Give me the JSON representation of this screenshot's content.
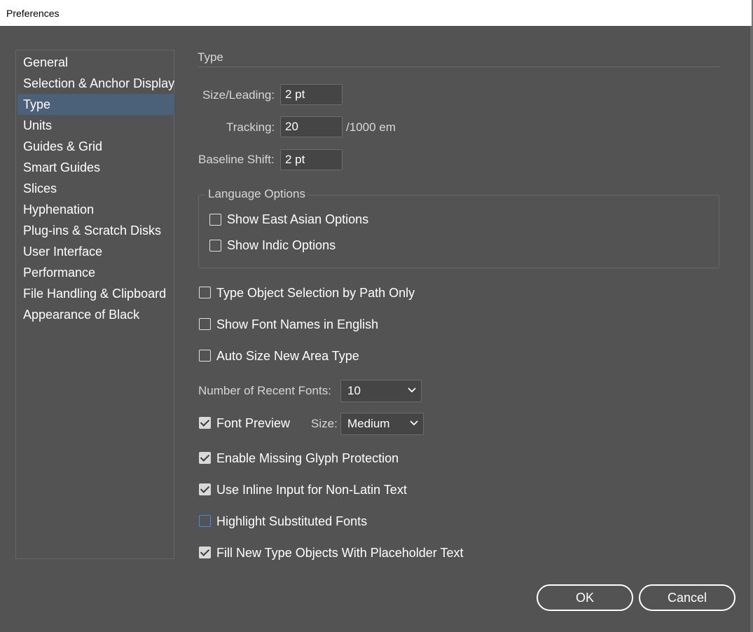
{
  "window": {
    "title": "Preferences"
  },
  "sidebar": {
    "items": [
      {
        "label": "General"
      },
      {
        "label": "Selection & Anchor Display"
      },
      {
        "label": "Type"
      },
      {
        "label": "Units"
      },
      {
        "label": "Guides & Grid"
      },
      {
        "label": "Smart Guides"
      },
      {
        "label": "Slices"
      },
      {
        "label": "Hyphenation"
      },
      {
        "label": "Plug-ins & Scratch Disks"
      },
      {
        "label": "User Interface"
      },
      {
        "label": "Performance"
      },
      {
        "label": "File Handling & Clipboard"
      },
      {
        "label": "Appearance of Black"
      }
    ],
    "selected": "Type"
  },
  "main": {
    "section_title": "Type",
    "size_leading": {
      "label": "Size/Leading:",
      "value": "2 pt"
    },
    "tracking": {
      "label": "Tracking:",
      "value": "20",
      "unit": "/1000 em"
    },
    "baseline_shift": {
      "label": "Baseline Shift:",
      "value": "2 pt"
    },
    "language_options": {
      "title": "Language Options",
      "east_asian": {
        "label": "Show East Asian Options",
        "checked": false
      },
      "indic": {
        "label": "Show Indic Options",
        "checked": false
      }
    },
    "type_object_selection": {
      "label": "Type Object Selection by Path Only",
      "checked": false
    },
    "font_names_english": {
      "label": "Show Font Names in English",
      "checked": false
    },
    "auto_size": {
      "label": "Auto Size New Area Type",
      "checked": false
    },
    "recent_fonts": {
      "label": "Number of Recent Fonts:",
      "value": "10"
    },
    "font_preview": {
      "label": "Font Preview",
      "checked": true,
      "size_label": "Size:",
      "size_value": "Medium"
    },
    "missing_glyph": {
      "label": "Enable Missing Glyph Protection",
      "checked": true
    },
    "inline_input": {
      "label": "Use Inline Input for Non-Latin Text",
      "checked": true
    },
    "highlight_substituted": {
      "label": "Highlight Substituted Fonts",
      "checked": false
    },
    "placeholder_text": {
      "label": "Fill New Type Objects With Placeholder Text",
      "checked": true
    }
  },
  "buttons": {
    "ok": "OK",
    "cancel": "Cancel"
  },
  "colors": {
    "background": "#535353",
    "selected": "#4b6079",
    "focus": "#3f90e0"
  }
}
